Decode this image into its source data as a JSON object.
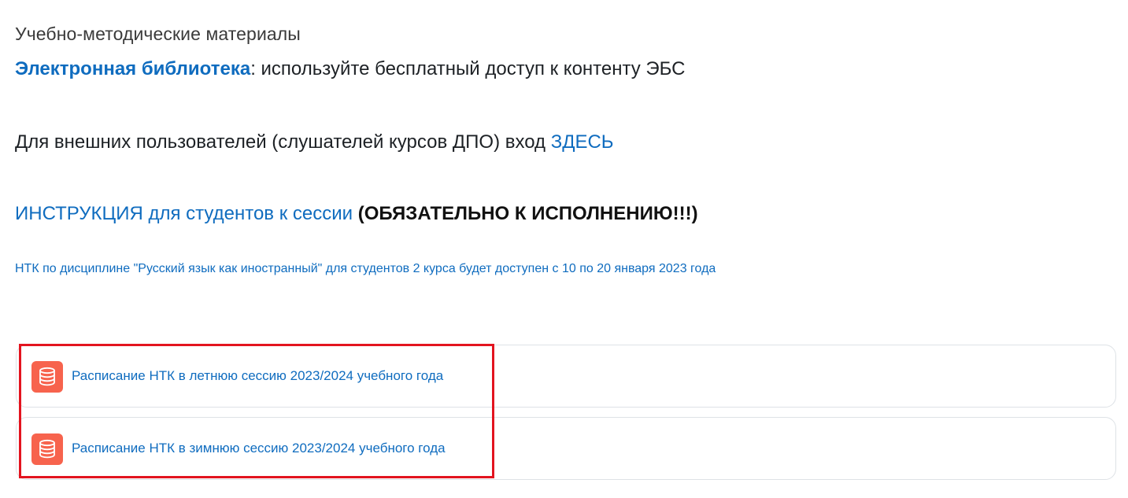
{
  "section_title": "Учебно-методические материалы",
  "library": {
    "link_text": "Электронная библиотека",
    "rest_text": ": используйте бесплатный доступ к контенту ЭБС"
  },
  "external_users": {
    "text": "Для внешних пользователей (слушателей курсов ДПО) вход ",
    "link_text": "ЗДЕСЬ"
  },
  "instruction": {
    "link_text": "ИНСТРУКЦИЯ для студентов к сессии",
    "strong_text": " (ОБЯЗАТЕЛЬНО К ИСПОЛНЕНИЮ!!!)"
  },
  "notice": "НТК по дисциплине \"Русский язык как иностранный\" для студентов 2 курса будет доступен с 10 по 20 января 2023 года",
  "activities": [
    {
      "icon": "database-icon",
      "label": "Расписание НТК в летнюю сессию 2023/2024 учебного года"
    },
    {
      "icon": "database-icon",
      "label": "Расписание НТК в зимнюю сессию 2023/2024 учебного года"
    }
  ],
  "colors": {
    "link": "#0f6cbf",
    "activity_icon_bg": "#f7634d",
    "highlight_border": "#e3141f"
  }
}
